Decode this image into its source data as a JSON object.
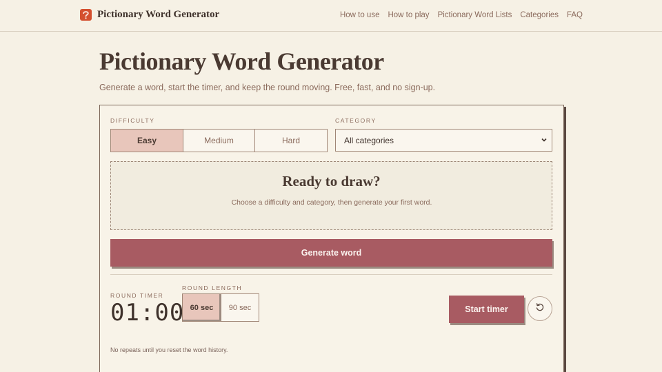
{
  "header": {
    "brand_title": "Pictionary Word Generator",
    "brand_icon": "question-mark-icon",
    "nav": [
      "How to use",
      "How to play",
      "Pictionary Word Lists",
      "Categories",
      "FAQ"
    ]
  },
  "hero": {
    "title": "Pictionary Word Generator",
    "subtitle": "Generate a word, start the timer, and keep the round moving. Free, fast, and no sign-up."
  },
  "card": {
    "difficulty": {
      "label": "DIFFICULTY",
      "options": [
        "Easy",
        "Medium",
        "Hard"
      ],
      "selected": "Easy"
    },
    "category": {
      "label": "CATEGORY",
      "value": "All categories"
    },
    "ready": {
      "title": "Ready to draw?",
      "text": "Choose a difficulty and category, then generate your first word."
    },
    "generate_label": "Generate word",
    "timer": {
      "label": "ROUND TIMER",
      "value": "01:00"
    },
    "round_length": {
      "label": "ROUND LENGTH",
      "options": [
        "60 sec",
        "90 sec"
      ],
      "selected": "60 sec"
    },
    "start_label": "Start timer",
    "reset_icon": "reset-icon",
    "note": "No repeats until you reset the word history."
  },
  "colors": {
    "background": "#f6f1e5",
    "accent": "#a85b62",
    "selected": "#e8c6bb",
    "brand_icon": "#d4502f"
  }
}
